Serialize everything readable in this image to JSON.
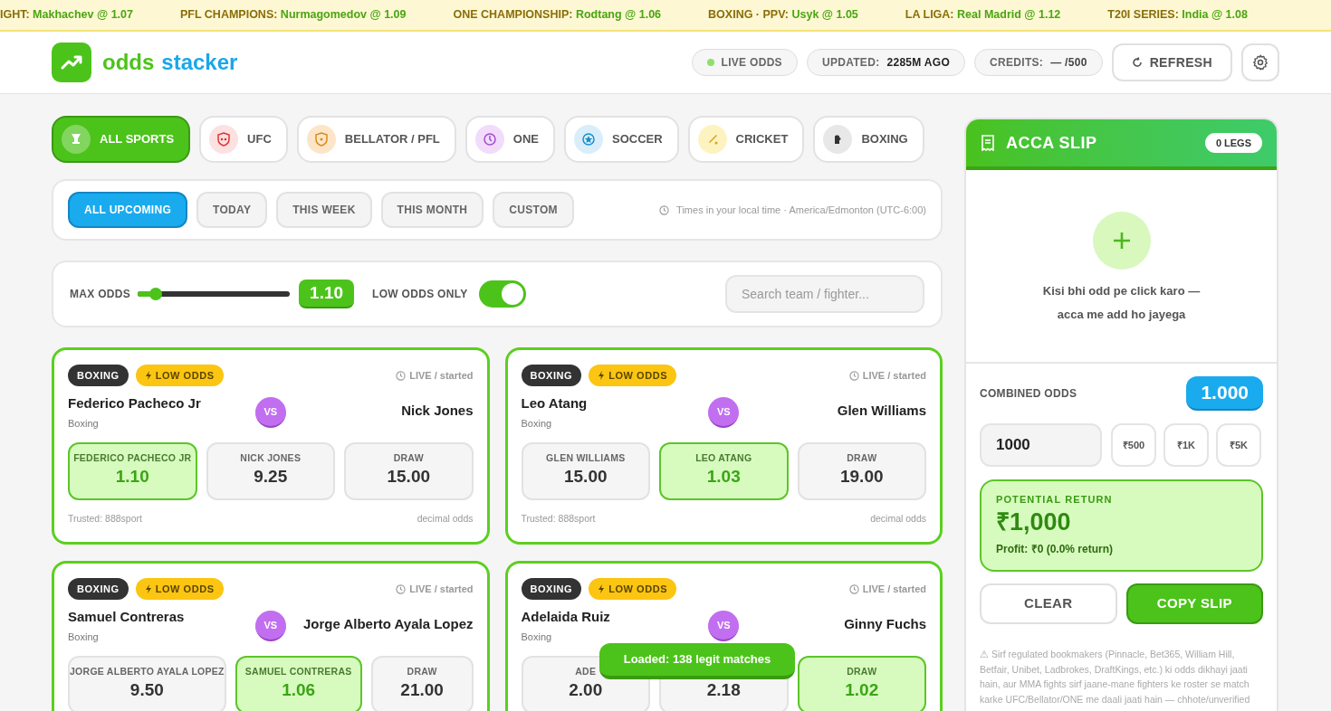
{
  "ticker": [
    {
      "label": "IGHT:",
      "value": "Makhachev @ 1.07"
    },
    {
      "label": "PFL CHAMPIONS:",
      "value": "Nurmagomedov @ 1.09"
    },
    {
      "label": "ONE CHAMPIONSHIP:",
      "value": "Rodtang @ 1.06"
    },
    {
      "label": "BOXING · PPV:",
      "value": "Usyk @ 1.05"
    },
    {
      "label": "LA LIGA:",
      "value": "Real Madrid @ 1.12"
    },
    {
      "label": "T20I SERIES:",
      "value": "India @ 1.08"
    }
  ],
  "header": {
    "logo_left": "odds",
    "logo_right": "stacker",
    "live": {
      "label": "LIVE ODDS",
      "on": true
    },
    "updated_label": "UPDATED:",
    "updated_value": "2285M AGO",
    "credits_label": "CREDITS:",
    "credits_value": "— /500",
    "refresh": "REFRESH"
  },
  "sports": [
    {
      "kind": "all",
      "label": "ALL SPORTS",
      "selected": true
    },
    {
      "kind": "ufc",
      "label": "UFC",
      "selected": false
    },
    {
      "kind": "bellator",
      "label": "BELLATOR / PFL",
      "selected": false
    },
    {
      "kind": "one",
      "label": "ONE",
      "selected": false
    },
    {
      "kind": "soccer",
      "label": "SOCCER",
      "selected": false
    },
    {
      "kind": "cricket",
      "label": "CRICKET",
      "selected": false
    },
    {
      "kind": "boxing",
      "label": "BOXING",
      "selected": false
    }
  ],
  "ranges": [
    {
      "label": "ALL UPCOMING",
      "selected": true
    },
    {
      "label": "TODAY",
      "selected": false
    },
    {
      "label": "THIS WEEK",
      "selected": false
    },
    {
      "label": "THIS MONTH",
      "selected": false
    },
    {
      "label": "CUSTOM",
      "selected": false
    }
  ],
  "timezone_note": "Times in your local time · America/Edmonton (UTC-6:00)",
  "filters": {
    "max_odds_label": "MAX ODDS",
    "max_odds": {
      "level": 0.12
    },
    "max_odds_value": "1.10",
    "low_odds_label": "LOW ODDS ONLY",
    "low_odds_only": true,
    "search": {
      "placeholder": "Search team / fighter..."
    }
  },
  "matches": [
    {
      "sport": "BOXING",
      "badge": "LOW ODDS",
      "status": "LIVE / started",
      "home": "Federico Pacheco Jr",
      "home_sub": "Boxing",
      "vs": "VS",
      "away": "Nick Jones",
      "odds": [
        {
          "label": "FEDERICO PACHECO JR",
          "value": "1.10",
          "selected": true
        },
        {
          "label": "NICK JONES",
          "value": "9.25",
          "selected": false
        },
        {
          "label": "DRAW",
          "value": "15.00",
          "selected": false
        }
      ],
      "source": "Trusted: 888sport",
      "format": "decimal odds"
    },
    {
      "sport": "BOXING",
      "badge": "LOW ODDS",
      "status": "LIVE / started",
      "home": "Leo Atang",
      "home_sub": "Boxing",
      "vs": "VS",
      "away": "Glen Williams",
      "odds": [
        {
          "label": "GLEN WILLIAMS",
          "value": "15.00",
          "selected": false
        },
        {
          "label": "LEO ATANG",
          "value": "1.03",
          "selected": true
        },
        {
          "label": "DRAW",
          "value": "19.00",
          "selected": false
        }
      ],
      "source": "Trusted: 888sport",
      "format": "decimal odds"
    },
    {
      "sport": "BOXING",
      "badge": "LOW ODDS",
      "status": "LIVE / started",
      "home": "Samuel Contreras",
      "home_sub": "Boxing",
      "vs": "VS",
      "away": "Jorge Alberto Ayala Lopez",
      "odds": [
        {
          "label": "JORGE ALBERTO AYALA LOPEZ",
          "value": "9.50",
          "selected": false
        },
        {
          "label": "SAMUEL CONTRERAS",
          "value": "1.06",
          "selected": true
        },
        {
          "label": "DRAW",
          "value": "21.00",
          "selected": false
        }
      ]
    },
    {
      "sport": "BOXING",
      "badge": "LOW ODDS",
      "status": "LIVE / started",
      "home": "Adelaida Ruiz",
      "home_sub": "Boxing",
      "vs": "VS",
      "away": "Ginny Fuchs",
      "odds": [
        {
          "label": "ADE",
          "value": "2.00",
          "selected": false
        },
        {
          "value": "2.18",
          "selected": false
        },
        {
          "label": "DRAW",
          "value": "1.02",
          "selected": true
        }
      ]
    }
  ],
  "toast": "Loaded: 138 legit matches",
  "slip": {
    "title": "ACCA SLIP",
    "legs": "0 LEGS",
    "empty_line1": "Kisi bhi odd pe click karo —",
    "empty_line2": "acca me add ho jayega",
    "combined_label": "COMBINED ODDS",
    "combined_value": "1.000",
    "stake": "1000",
    "quick": [
      "₹500",
      "₹1K",
      "₹5K"
    ],
    "return_label": "POTENTIAL RETURN",
    "return_value": "₹1,000",
    "profit": "Profit: ₹0 (0.0% return)",
    "clear": "CLEAR",
    "copy": "COPY SLIP",
    "disclaimer": "⚠ Sirf regulated bookmakers (Pinnacle, Bet365, William Hill, Betfair, Unibet, Ladbrokes, DraftKings, etc.) ki odds dikhayi jaati hain, aur MMA fights sirf jaane-mane fighters ke roster se match karke UFC/Bellator/ONE me daali jaati hain — chhote/unverified"
  }
}
